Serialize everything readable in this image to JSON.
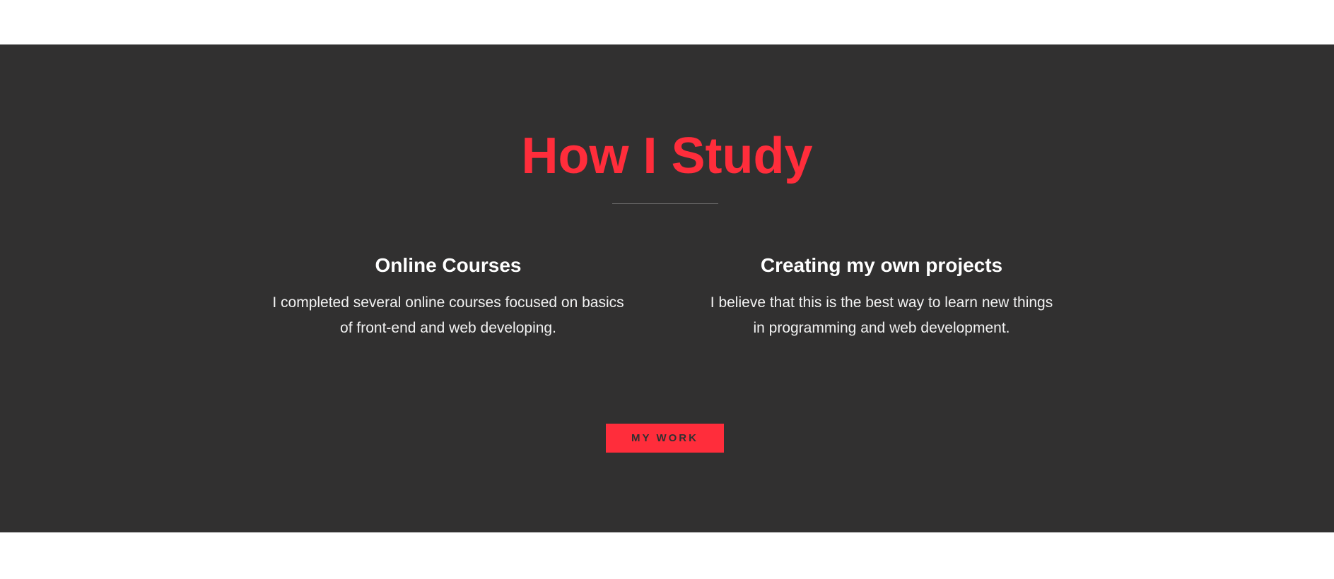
{
  "colors": {
    "accent": "#ff2d3b",
    "section_background": "#313030",
    "page_background": "#ffffff",
    "heading_text": "#ffffff",
    "body_text": "#f2f2f2",
    "divider": "#6f6e6e"
  },
  "study": {
    "title": "How I Study",
    "columns": [
      {
        "heading": "Online Courses",
        "text": "I completed several online courses focused on basics of front-end and web developing."
      },
      {
        "heading": "Creating my own projects",
        "text": "I believe that this is the best way to learn new things in programming and web development."
      }
    ],
    "button_label": "MY WORK"
  }
}
